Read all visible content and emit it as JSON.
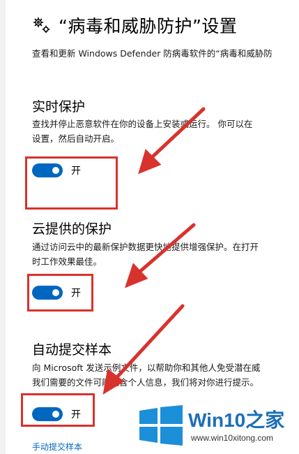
{
  "header": {
    "title": "“病毒和威胁防护”设置",
    "subtitle": "查看和更新 Windows Defender 防病毒软件的“病毒和威胁防"
  },
  "sections": [
    {
      "heading": "实时保护",
      "description_lines": [
        "查找并停止恶意软件在你的设备上安装或运行。 你可以在",
        "设置，然后自动开启。"
      ],
      "toggle_state": "开"
    },
    {
      "heading": "云提供的保护",
      "description_lines": [
        "通过访问云中的最新保护数据更快地提供增强保护。在打开",
        "时工作效果最佳。"
      ],
      "toggle_state": "开"
    },
    {
      "heading": "自动提交样本",
      "description_lines": [
        "向 Microsoft 发送示例文件，以帮助你和其他人免受潜在威",
        "我们需要的文件可能包含个人信息，我们将对你进行提示。"
      ],
      "toggle_state": "开"
    }
  ],
  "link": {
    "label": "手动提交样本"
  },
  "watermark": {
    "brand_a": "Win10",
    "brand_b": "之家",
    "url": "www.win10xitong.com"
  },
  "colors": {
    "accent": "#0067c0",
    "annotation_red": "#d8322d",
    "watermark_blue": "#1c6fb8"
  }
}
